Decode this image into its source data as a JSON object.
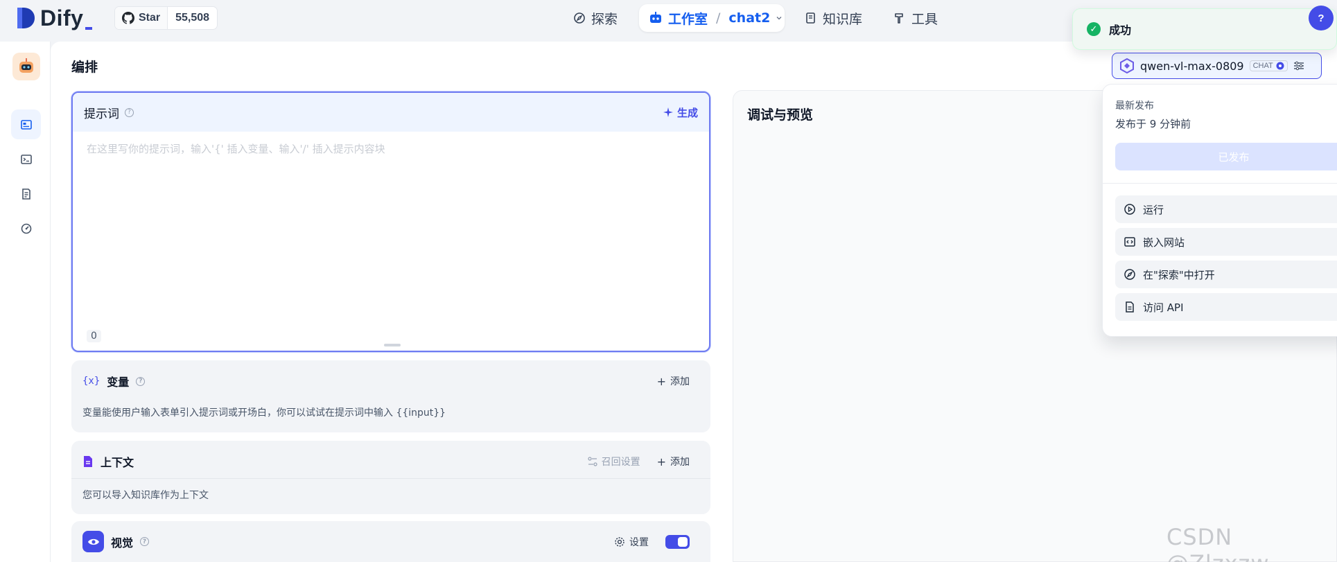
{
  "brand": {
    "name": "Dify"
  },
  "github": {
    "star_label": "Star",
    "count": "55,508"
  },
  "nav": {
    "explore": "探索",
    "studio": "工作室",
    "app_name": "chat2",
    "knowledge": "知识库",
    "tools": "工具"
  },
  "toast": {
    "message": "成功"
  },
  "user_avatar": "?",
  "page": {
    "title": "编排"
  },
  "prompt": {
    "title": "提示词",
    "generate_label": "生成",
    "placeholder": "在这里写你的提示词，输入'{' 插入变量、输入'/' 插入提示内容块",
    "char_count": "0"
  },
  "variables": {
    "icon_text": "{x}",
    "title": "变量",
    "add_label": "添加",
    "description": "变量能使用户输入表单引入提示词或开场白，你可以试试在提示词中输入 {{input}}"
  },
  "context": {
    "title": "上下文",
    "retrieval_label": "召回设置",
    "add_label": "添加",
    "description": "您可以导入知识库作为上下文"
  },
  "vision": {
    "title": "视觉",
    "settings_label": "设置",
    "enabled": true
  },
  "debug": {
    "title": "调试与预览"
  },
  "model": {
    "name": "qwen-vl-max-0809",
    "mode_badge": "CHAT"
  },
  "publish_popover": {
    "latest_label": "最新发布",
    "published_time": "发布于 9 分钟前",
    "published_button": "已发布",
    "items": [
      {
        "label": "运行",
        "icon": "play-circle-icon"
      },
      {
        "label": "嵌入网站",
        "icon": "embed-code-icon"
      },
      {
        "label": "在\"探索\"中打开",
        "icon": "compass-icon"
      },
      {
        "label": "访问 API",
        "icon": "file-api-icon"
      }
    ]
  },
  "watermark": "CSDN @Zlzxzw",
  "colors": {
    "accent": "#444ce7",
    "link": "#155eef",
    "success": "#16b364"
  }
}
